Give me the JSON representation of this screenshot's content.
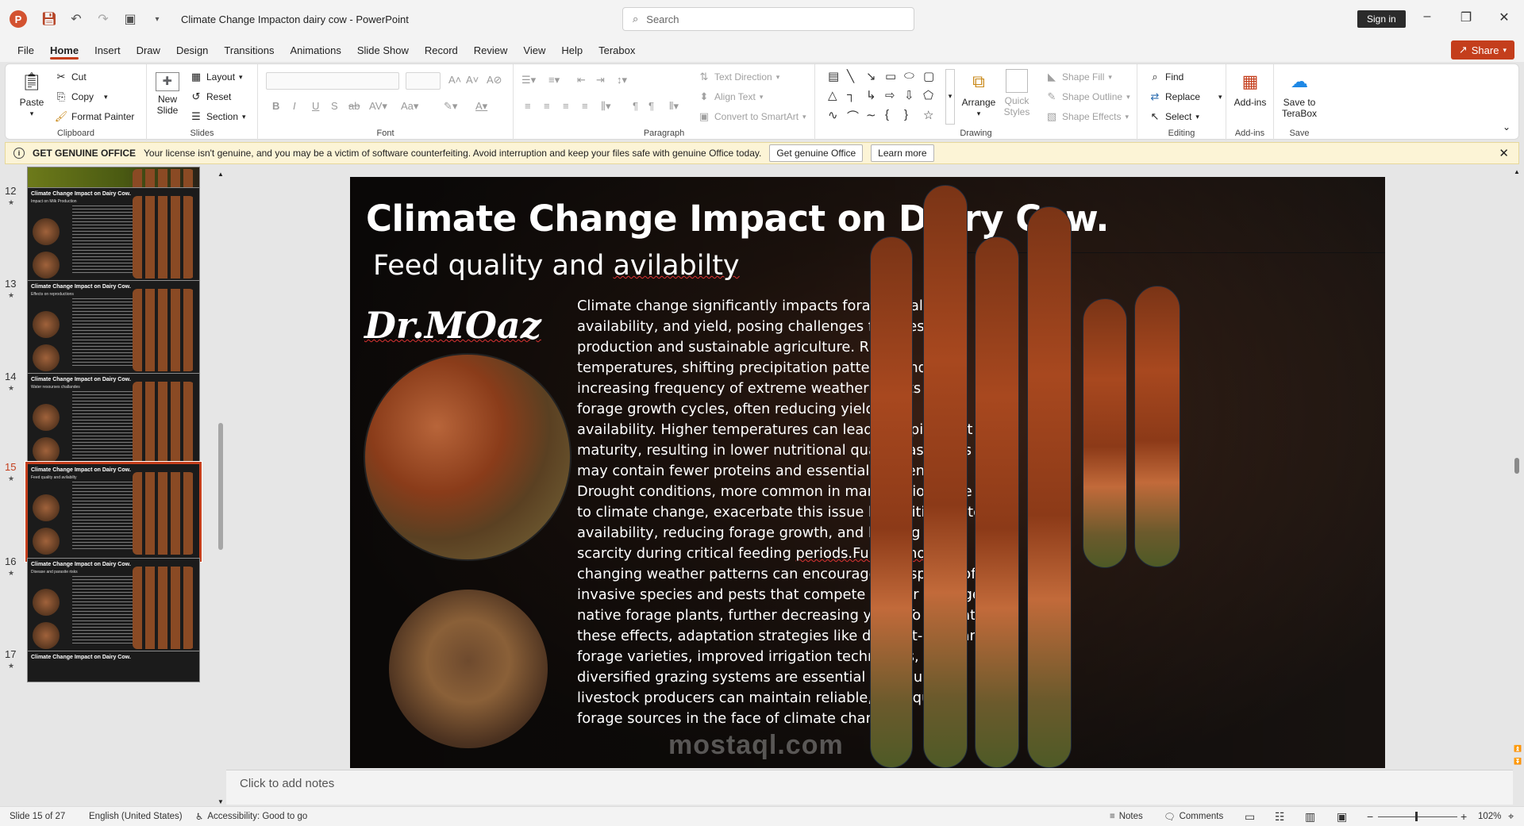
{
  "titlebar": {
    "logo": "P",
    "doc_title": "Climate Change Impacton dairy cow  -  PowerPoint",
    "search_placeholder": "Search",
    "signin": "Sign in",
    "icons": [
      "save-icon",
      "undo-icon",
      "redo-icon",
      "present-icon",
      "customize-icon"
    ]
  },
  "menu": {
    "tabs": [
      "File",
      "Home",
      "Insert",
      "Draw",
      "Design",
      "Transitions",
      "Animations",
      "Slide Show",
      "Record",
      "Review",
      "View",
      "Help",
      "Terabox"
    ],
    "active": "Home",
    "share": "Share"
  },
  "ribbon": {
    "clipboard": {
      "label": "Clipboard",
      "paste": "Paste",
      "cut": "Cut",
      "copy": "Copy",
      "format_painter": "Format Painter"
    },
    "slides": {
      "label": "Slides",
      "new_slide": "New\nSlide",
      "layout": "Layout",
      "reset": "Reset",
      "section": "Section"
    },
    "font": {
      "label": "Font"
    },
    "paragraph": {
      "label": "Paragraph",
      "text_direction": "Text Direction",
      "align_text": "Align Text",
      "convert_smartart": "Convert to SmartArt"
    },
    "drawing": {
      "label": "Drawing",
      "arrange": "Arrange",
      "quick_styles": "Quick\nStyles",
      "shape_fill": "Shape Fill",
      "shape_outline": "Shape Outline",
      "shape_effects": "Shape Effects"
    },
    "editing": {
      "label": "Editing",
      "find": "Find",
      "replace": "Replace",
      "select": "Select"
    },
    "addins": {
      "label": "Add-ins",
      "addins_btn": "Add-ins"
    },
    "save": {
      "label": "Save",
      "save_terabox": "Save to\nTeraBox"
    }
  },
  "notification": {
    "heading": "GET GENUINE OFFICE",
    "message": "Your license isn't genuine, and you may be a victim of software counterfeiting. Avoid interruption and keep your files safe with genuine Office today.",
    "btn_genuine": "Get genuine Office",
    "btn_learn": "Learn more"
  },
  "thumbnails": [
    {
      "num": "12",
      "title": "Climate Change Impact on Dairy Cow.",
      "subtitle": "Impact on Milk Production"
    },
    {
      "num": "13",
      "title": "Climate Change Impact on Dairy Cow.",
      "subtitle": "Effects on reproductions"
    },
    {
      "num": "14",
      "title": "Climate Change Impact on Dairy Cow.",
      "subtitle": "Water resourses challandes"
    },
    {
      "num": "15",
      "title": "Climate Change Impact on Dairy Cow.",
      "subtitle": "Feed quality and avilabilty"
    },
    {
      "num": "16",
      "title": "Climate Change Impact on Dairy Cow.",
      "subtitle": "Disease and parasite risks"
    },
    {
      "num": "17",
      "title": "Climate Change Impact on Dairy Cow.",
      "subtitle": ""
    }
  ],
  "slide": {
    "title": "Climate Change Impact on Dairy Cow.",
    "subtitle_a": "Feed quality and ",
    "subtitle_b": "avilabilty",
    "author": "Dr.MOaz",
    "body_a": "Climate change significantly impacts forage quality, availability, and yield, posing challenges for livestock production and sustainable agriculture. Rising temperatures, shifting precipitation patterns, and increasing frequency of extreme weather events alter forage growth cycles, often reducing yields and availability. Higher temperatures can lead to rapid plant maturity, resulting in lower nutritional quality, as plants may contain fewer proteins and essential nutrients. Drought conditions, more common in many regions due to climate change, exacerbate this issue by limiting water availability, reducing forage growth, and leading to scarcity during critical feeding ",
    "body_b": "periods.Furthermore",
    "body_c": ", changing weather patterns can encourage the spread of invasive species and pests that compete with or damage native forage plants, further decreasing yield. To mitigate these effects, adaptation strategies like drought-resistant forage varieties, improved irrigation techniques, and diversified grazing systems are essential to ensure livestock producers can maintain reliable, high-quality forage sources in the face of climate change."
  },
  "notes_placeholder": "Click to add notes",
  "status": {
    "slide_info": "Slide 15 of 27",
    "language": "English (United States)",
    "accessibility": "Accessibility: Good to go",
    "notes": "Notes",
    "comments": "Comments",
    "zoom": "102%"
  },
  "watermark": "mostaql.com"
}
